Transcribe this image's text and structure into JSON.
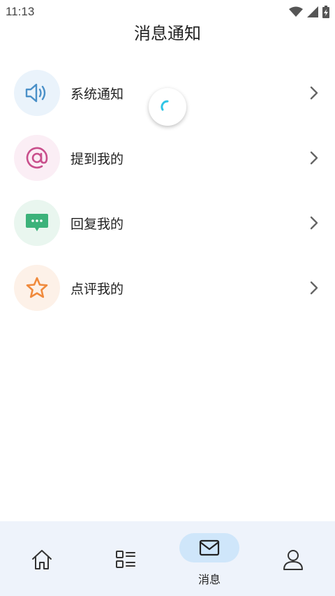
{
  "status_bar": {
    "time": "11:13",
    "icons": [
      "wifi-icon",
      "cell-signal-icon",
      "battery-charging-icon"
    ]
  },
  "header": {
    "title": "消息通知"
  },
  "messages": [
    {
      "label": "系统通知",
      "icon": "speaker-icon",
      "icon_color": "#4a90c8",
      "bg_color": "#eaf3fb"
    },
    {
      "label": "提到我的",
      "icon": "at-sign-icon",
      "icon_color": "#c94f8c",
      "bg_color": "#fbeef5"
    },
    {
      "label": "回复我的",
      "icon": "chat-bubble-icon",
      "icon_color": "#3cb27a",
      "bg_color": "#e9f6ef"
    },
    {
      "label": "点评我的",
      "icon": "star-icon",
      "icon_color": "#f08a3c",
      "bg_color": "#fdf1e8"
    }
  ],
  "loading": {
    "icon": "loading-spinner-icon",
    "color": "#2ec5e6"
  },
  "bottom_nav": {
    "items": [
      {
        "icon": "home-icon",
        "label": "",
        "active": false
      },
      {
        "icon": "list-icon",
        "label": "",
        "active": false
      },
      {
        "icon": "mail-icon",
        "label": "消息",
        "active": true
      },
      {
        "icon": "user-icon",
        "label": "",
        "active": false
      }
    ],
    "active_color": "#cfe6fa"
  }
}
